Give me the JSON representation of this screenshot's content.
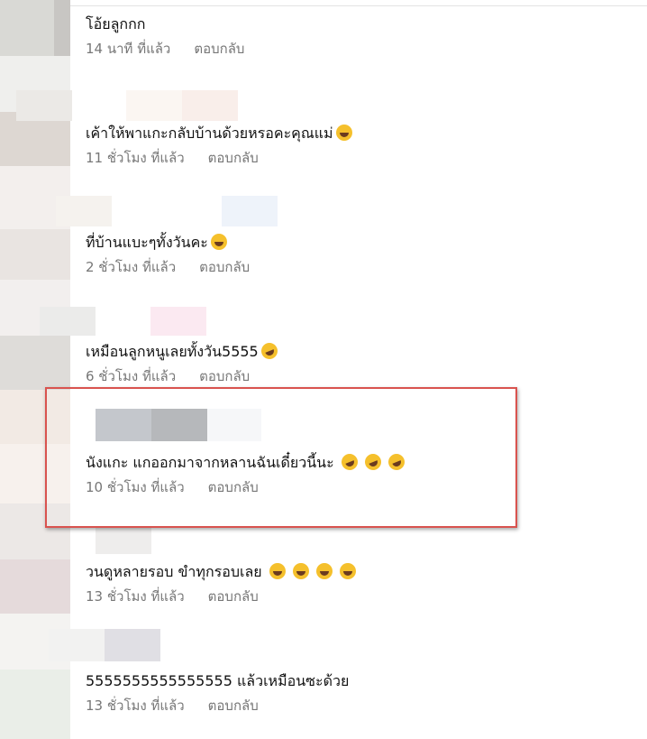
{
  "comments": [
    {
      "text": "โอ้ยลูกกก",
      "time": "14 นาที ที่แล้ว",
      "reply": "ตอบกลับ",
      "emojis": []
    },
    {
      "text": "เค้าให้พาแกะกลับบ้านด้วยหรอคะคุณแม่",
      "time": "11 ชั่วโมง ที่แล้ว",
      "reply": "ตอบกลับ",
      "emojis": [
        "laugh"
      ]
    },
    {
      "text": "ที่บ้านแบะๆทั้งวันคะ",
      "time": "2 ชั่วโมง ที่แล้ว",
      "reply": "ตอบกลับ",
      "emojis": [
        "laugh"
      ]
    },
    {
      "text": "เหมือนลูกหนูเลยทั้งวัน5555",
      "time": "6 ชั่วโมง ที่แล้ว",
      "reply": "ตอบกลับ",
      "emojis": [
        "rofl"
      ]
    },
    {
      "text": "นังแกะ แกออกมาจากหลานฉันเดี๋ยวนี้นะ",
      "time": "10 ชั่วโมง ที่แล้ว",
      "reply": "ตอบกลับ",
      "emojis": [
        "rofl",
        "rofl",
        "rofl"
      ]
    },
    {
      "text": "วนดูหลายรอบ ขำทุกรอบเลย",
      "time": "13 ชั่วโมง ที่แล้ว",
      "reply": "ตอบกลับ",
      "emojis": [
        "laugh",
        "laugh",
        "laugh",
        "laugh"
      ]
    },
    {
      "text": "5555555555555555 แล้วเหมือนซะด้วย",
      "time": "13 ชั่วโมง ที่แล้ว",
      "reply": "ตอบกลับ",
      "emojis": []
    }
  ],
  "highlight_color": "#d9534f"
}
